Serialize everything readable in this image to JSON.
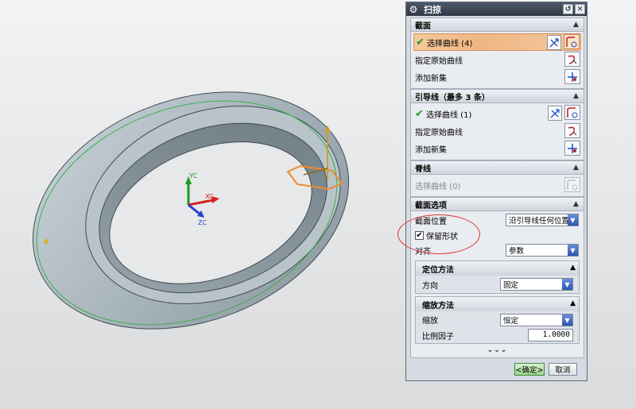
{
  "dialog": {
    "title": "扫掠",
    "reset_icon": "reset-icon",
    "close_icon": "close-icon"
  },
  "section": {
    "title": "截面",
    "select_curve": "选择曲线 (4)",
    "specify_origin": "指定原始曲线",
    "add_new_set": "添加新集"
  },
  "guides": {
    "title": "引导线（最多 3 条）",
    "select_curve": "选择曲线 (1)",
    "specify_origin": "指定原始曲线",
    "add_new_set": "添加新集"
  },
  "spine": {
    "title": "脊线",
    "select_curve": "选择曲线 (0)"
  },
  "section_options": {
    "title": "截面选项",
    "position_label": "截面位置",
    "position_value": "沿引导线任何位置",
    "preserve_shape_label": "保留形状",
    "preserve_shape_checked": true,
    "align_label": "对齐",
    "align_value": "参数",
    "orientation": {
      "title": "定位方法",
      "direction_label": "方向",
      "direction_value": "固定"
    },
    "scaling": {
      "title": "缩放方法",
      "scale_label": "缩放",
      "scale_value": "恒定",
      "factor_label": "比例因子",
      "factor_value": "1.0000"
    }
  },
  "more_symbol": "⌄⌄⌄",
  "footer": {
    "ok_label": "<确定>",
    "cancel_label": "取消"
  },
  "axes": {
    "yc": "YC",
    "xc": "XC",
    "zc": "ZC"
  },
  "colors": {
    "selected_row": "#f0b682",
    "ok_button": "#9dd68c",
    "annotation": "#dd3333",
    "model": "#a9b5bd"
  }
}
